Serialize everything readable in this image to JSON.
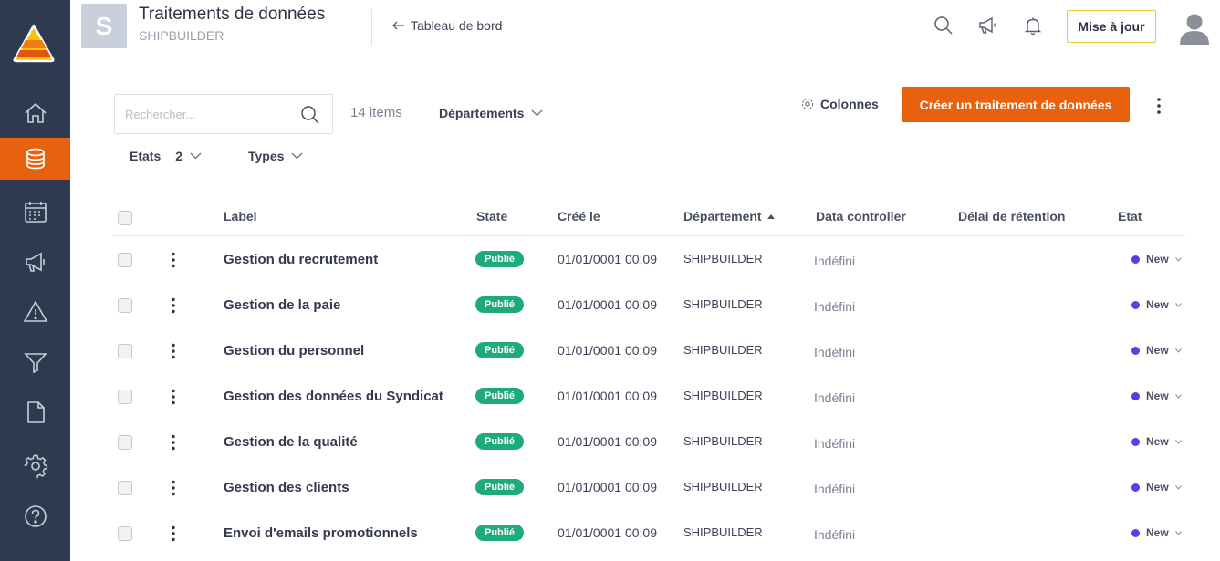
{
  "colors": {
    "sidebar": "#2e3a4f",
    "accent": "#e8610f",
    "published": "#1eaa79",
    "state_dot": "#5b3ee6"
  },
  "sidebar": {
    "items": [
      {
        "icon": "home-icon"
      },
      {
        "icon": "database-icon",
        "active": true
      },
      {
        "icon": "calendar-icon"
      },
      {
        "icon": "megaphone-icon"
      },
      {
        "icon": "warning-icon"
      },
      {
        "icon": "funnel-icon"
      },
      {
        "icon": "document-icon"
      },
      {
        "icon": "gear-icon"
      },
      {
        "icon": "help-icon"
      }
    ]
  },
  "header": {
    "avatar_letter": "S",
    "title": "Traitements de données",
    "subtitle": "SHIPBUILDER",
    "back_link": "Tableau de bord",
    "update_button": "Mise à jour"
  },
  "toolbar": {
    "search_placeholder": "Rechercher...",
    "items_count": "14 items",
    "departments_filter": "Départements",
    "columns_button": "Colonnes",
    "create_button": "Créer un traitement de données",
    "states_filter": "Etats",
    "states_count": "2",
    "types_filter": "Types"
  },
  "table": {
    "columns": {
      "label": "Label",
      "state": "State",
      "created": "Créé le",
      "department": "Département",
      "data_controller": "Data controller",
      "retention": "Délai de rétention",
      "etat": "Etat"
    },
    "rows": [
      {
        "label": "Gestion du recrutement",
        "state": "Publié",
        "created": "01/01/0001 00:09",
        "department": "SHIPBUILDER",
        "data_controller": "Indéfini",
        "etat": "New"
      },
      {
        "label": "Gestion de la paie",
        "state": "Publié",
        "created": "01/01/0001 00:09",
        "department": "SHIPBUILDER",
        "data_controller": "Indéfini",
        "etat": "New"
      },
      {
        "label": "Gestion du personnel",
        "state": "Publié",
        "created": "01/01/0001 00:09",
        "department": "SHIPBUILDER",
        "data_controller": "Indéfini",
        "etat": "New"
      },
      {
        "label": "Gestion des données du Syndicat",
        "state": "Publié",
        "created": "01/01/0001 00:09",
        "department": "SHIPBUILDER",
        "data_controller": "Indéfini",
        "etat": "New"
      },
      {
        "label": "Gestion de la qualité",
        "state": "Publié",
        "created": "01/01/0001 00:09",
        "department": "SHIPBUILDER",
        "data_controller": "Indéfini",
        "etat": "New"
      },
      {
        "label": "Gestion des clients",
        "state": "Publié",
        "created": "01/01/0001 00:09",
        "department": "SHIPBUILDER",
        "data_controller": "Indéfini",
        "etat": "New"
      },
      {
        "label": "Envoi d'emails promotionnels",
        "state": "Publié",
        "created": "01/01/0001 00:09",
        "department": "SHIPBUILDER",
        "data_controller": "Indéfini",
        "etat": "New"
      }
    ]
  }
}
